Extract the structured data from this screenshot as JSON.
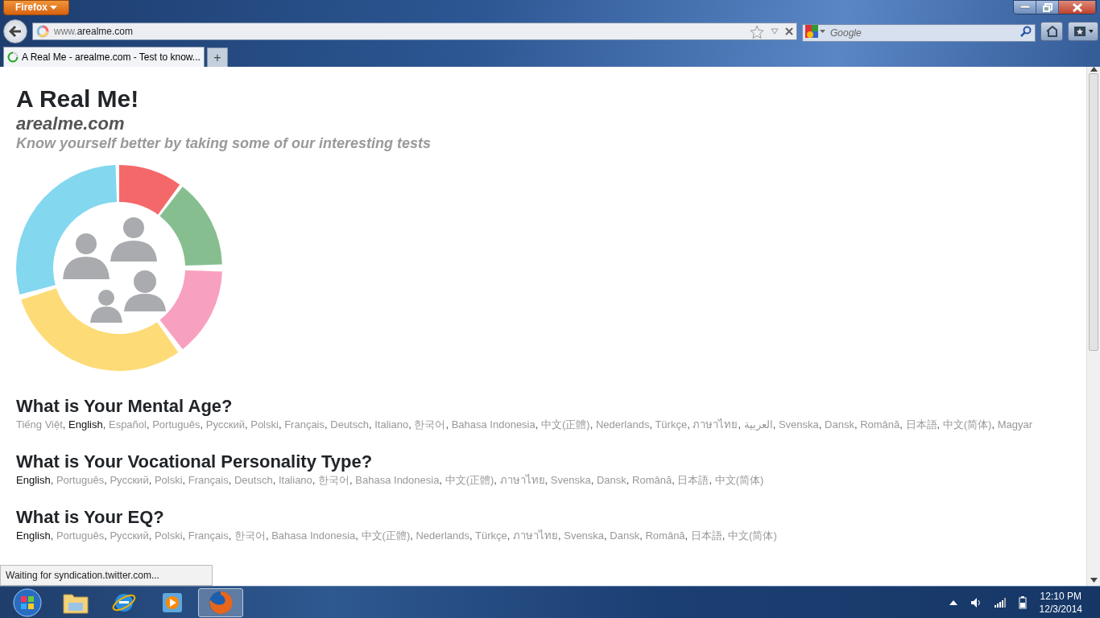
{
  "browser": {
    "menu_button": "Firefox",
    "address": {
      "prefix": "www.",
      "domain": "arealme.com"
    },
    "search": {
      "placeholder": "Google"
    },
    "tabs": [
      {
        "label": "A Real Me - arealme.com - Test to know...",
        "selected": true
      }
    ],
    "new_tab": "+"
  },
  "page": {
    "separator": ",",
    "title": "A Real Me!",
    "domain": "arealme.com",
    "tagline": "Know yourself better by taking some of our interesting tests",
    "tests": [
      {
        "title": "What is Your Mental Age?",
        "languages": [
          {
            "label": "Tiếng Việt",
            "selected": false
          },
          {
            "label": "English",
            "selected": true
          },
          {
            "label": "Español",
            "selected": false
          },
          {
            "label": "Português",
            "selected": false
          },
          {
            "label": "Русский",
            "selected": false
          },
          {
            "label": "Polski",
            "selected": false
          },
          {
            "label": "Français",
            "selected": false
          },
          {
            "label": "Deutsch",
            "selected": false
          },
          {
            "label": "Italiano",
            "selected": false
          },
          {
            "label": "한국어",
            "selected": false
          },
          {
            "label": "Bahasa Indonesia",
            "selected": false
          },
          {
            "label": "中文(正體)",
            "selected": false
          },
          {
            "label": "Nederlands",
            "selected": false
          },
          {
            "label": "Türkçe",
            "selected": false
          },
          {
            "label": "ภาษาไทย",
            "selected": false
          },
          {
            "label": "العربية",
            "selected": false
          },
          {
            "label": "Svenska",
            "selected": false
          },
          {
            "label": "Dansk",
            "selected": false
          },
          {
            "label": "Română",
            "selected": false
          },
          {
            "label": "日本語",
            "selected": false
          },
          {
            "label": "中文(简体)",
            "selected": false
          },
          {
            "label": "Magyar",
            "selected": false
          }
        ]
      },
      {
        "title": "What is Your Vocational Personality Type?",
        "languages": [
          {
            "label": "English",
            "selected": true
          },
          {
            "label": "Português",
            "selected": false
          },
          {
            "label": "Русский",
            "selected": false
          },
          {
            "label": "Polski",
            "selected": false
          },
          {
            "label": "Français",
            "selected": false
          },
          {
            "label": "Deutsch",
            "selected": false
          },
          {
            "label": "Italiano",
            "selected": false
          },
          {
            "label": "한국어",
            "selected": false
          },
          {
            "label": "Bahasa Indonesia",
            "selected": false
          },
          {
            "label": "中文(正體)",
            "selected": false
          },
          {
            "label": "ภาษาไทย",
            "selected": false
          },
          {
            "label": "Svenska",
            "selected": false
          },
          {
            "label": "Dansk",
            "selected": false
          },
          {
            "label": "Română",
            "selected": false
          },
          {
            "label": "日本語",
            "selected": false
          },
          {
            "label": "中文(简体)",
            "selected": false
          }
        ]
      },
      {
        "title": "What is Your EQ?",
        "languages": [
          {
            "label": "English",
            "selected": true
          },
          {
            "label": "Português",
            "selected": false
          },
          {
            "label": "Русский",
            "selected": false
          },
          {
            "label": "Polski",
            "selected": false
          },
          {
            "label": "Français",
            "selected": false
          },
          {
            "label": "한국어",
            "selected": false
          },
          {
            "label": "Bahasa Indonesia",
            "selected": false
          },
          {
            "label": "中文(正體)",
            "selected": false
          },
          {
            "label": "Nederlands",
            "selected": false
          },
          {
            "label": "Türkçe",
            "selected": false
          },
          {
            "label": "ภาษาไทย",
            "selected": false
          },
          {
            "label": "Svenska",
            "selected": false
          },
          {
            "label": "Dansk",
            "selected": false
          },
          {
            "label": "Română",
            "selected": false
          },
          {
            "label": "日本語",
            "selected": false
          },
          {
            "label": "中文(简体)",
            "selected": false
          }
        ]
      }
    ]
  },
  "status_text": "Waiting for syndication.twitter.com...",
  "taskbar": {
    "time": "12:10 PM",
    "date": "12/3/2014"
  }
}
